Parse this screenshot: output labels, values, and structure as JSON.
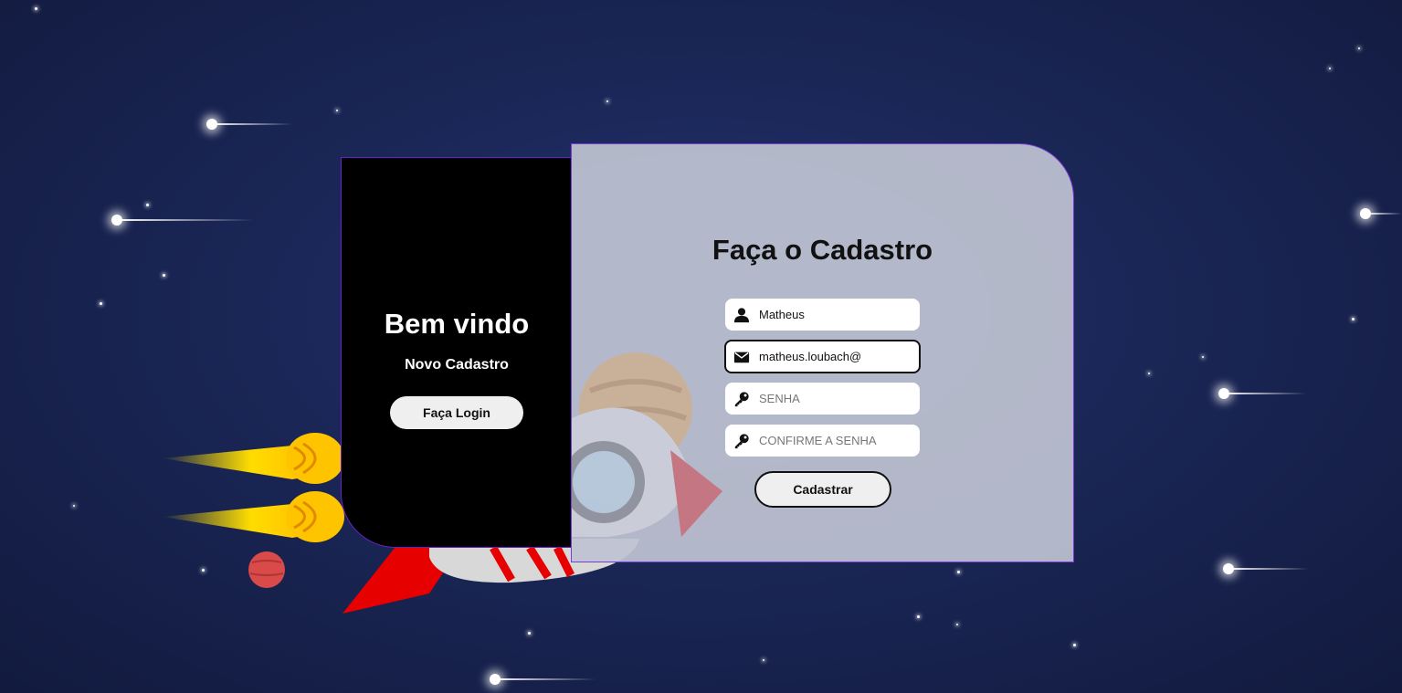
{
  "left": {
    "title": "Bem vindo",
    "subtitle": "Novo Cadastro",
    "login_button": "Faça Login"
  },
  "form": {
    "title": "Faça o Cadastro",
    "name_value": "Matheus",
    "email_value": "matheus.loubach@",
    "password_placeholder": "SENHA",
    "confirm_placeholder": "CONFIRME A SENHA",
    "submit_label": "Cadastrar",
    "icons": [
      "user-icon",
      "envelope-icon",
      "key-icon",
      "key-icon"
    ]
  },
  "colors": {
    "background": "#1a2656",
    "left_panel": "#000000",
    "right_panel": "#bec3d2",
    "panel_border": "#7a3ad6",
    "rocket_red": "#e60000",
    "flame_yellow": "#ffd200"
  }
}
